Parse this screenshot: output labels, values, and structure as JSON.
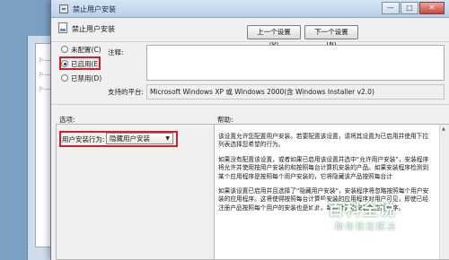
{
  "window": {
    "title": "禁止用户安装",
    "controls": {
      "minimize": "—",
      "maximize": "□",
      "close": "✕"
    }
  },
  "header": {
    "policy_name": "禁止用户安装",
    "prev_button": "上一个设置(P)",
    "next_button": "下一个设置(N)"
  },
  "state": {
    "options": [
      {
        "label": "未配置(C)",
        "selected": false
      },
      {
        "label": "已启用(E)",
        "selected": true
      },
      {
        "label": "已禁用(D)",
        "selected": false
      }
    ]
  },
  "comment": {
    "label": "注释:",
    "value": ""
  },
  "supported_on": {
    "label": "支持的平台:",
    "value": "Microsoft Windows XP 或 Windows 2000(含 Windows Installer v2.0)"
  },
  "options_section": {
    "title": "选项:",
    "field_label": "用户安装行为:",
    "field_value": "隐藏用户安装"
  },
  "help_section": {
    "title": "帮助:",
    "paragraphs": [
      "该设置允许您配置用户安装。若要配置该设置，请将其设置为已启用并使用下拉列表选择您希望的行为。",
      "如果没有配置该设置，或者如果已启用该设置并选中“允许用户安装”，安装程序将允许并使用按用户安装的和按照每台计算机安装的产品。如果安装程序检测到某个应用程序是按照每个用户安装的，它将隐藏该产品按照每台计",
      "如果该设置已启用并且选择了“隐藏用户安装”，安装程序将忽略按照每个用户安装的应用程序。这将使得按照每台计算机安装的应用程序对用户可见，即使已经注册产品按照每个用户的安装也是如此，每台计算机安装的应用程序。"
    ]
  },
  "watermark": {
    "main": "百科全说",
    "sub": "助你轻松解决"
  }
}
